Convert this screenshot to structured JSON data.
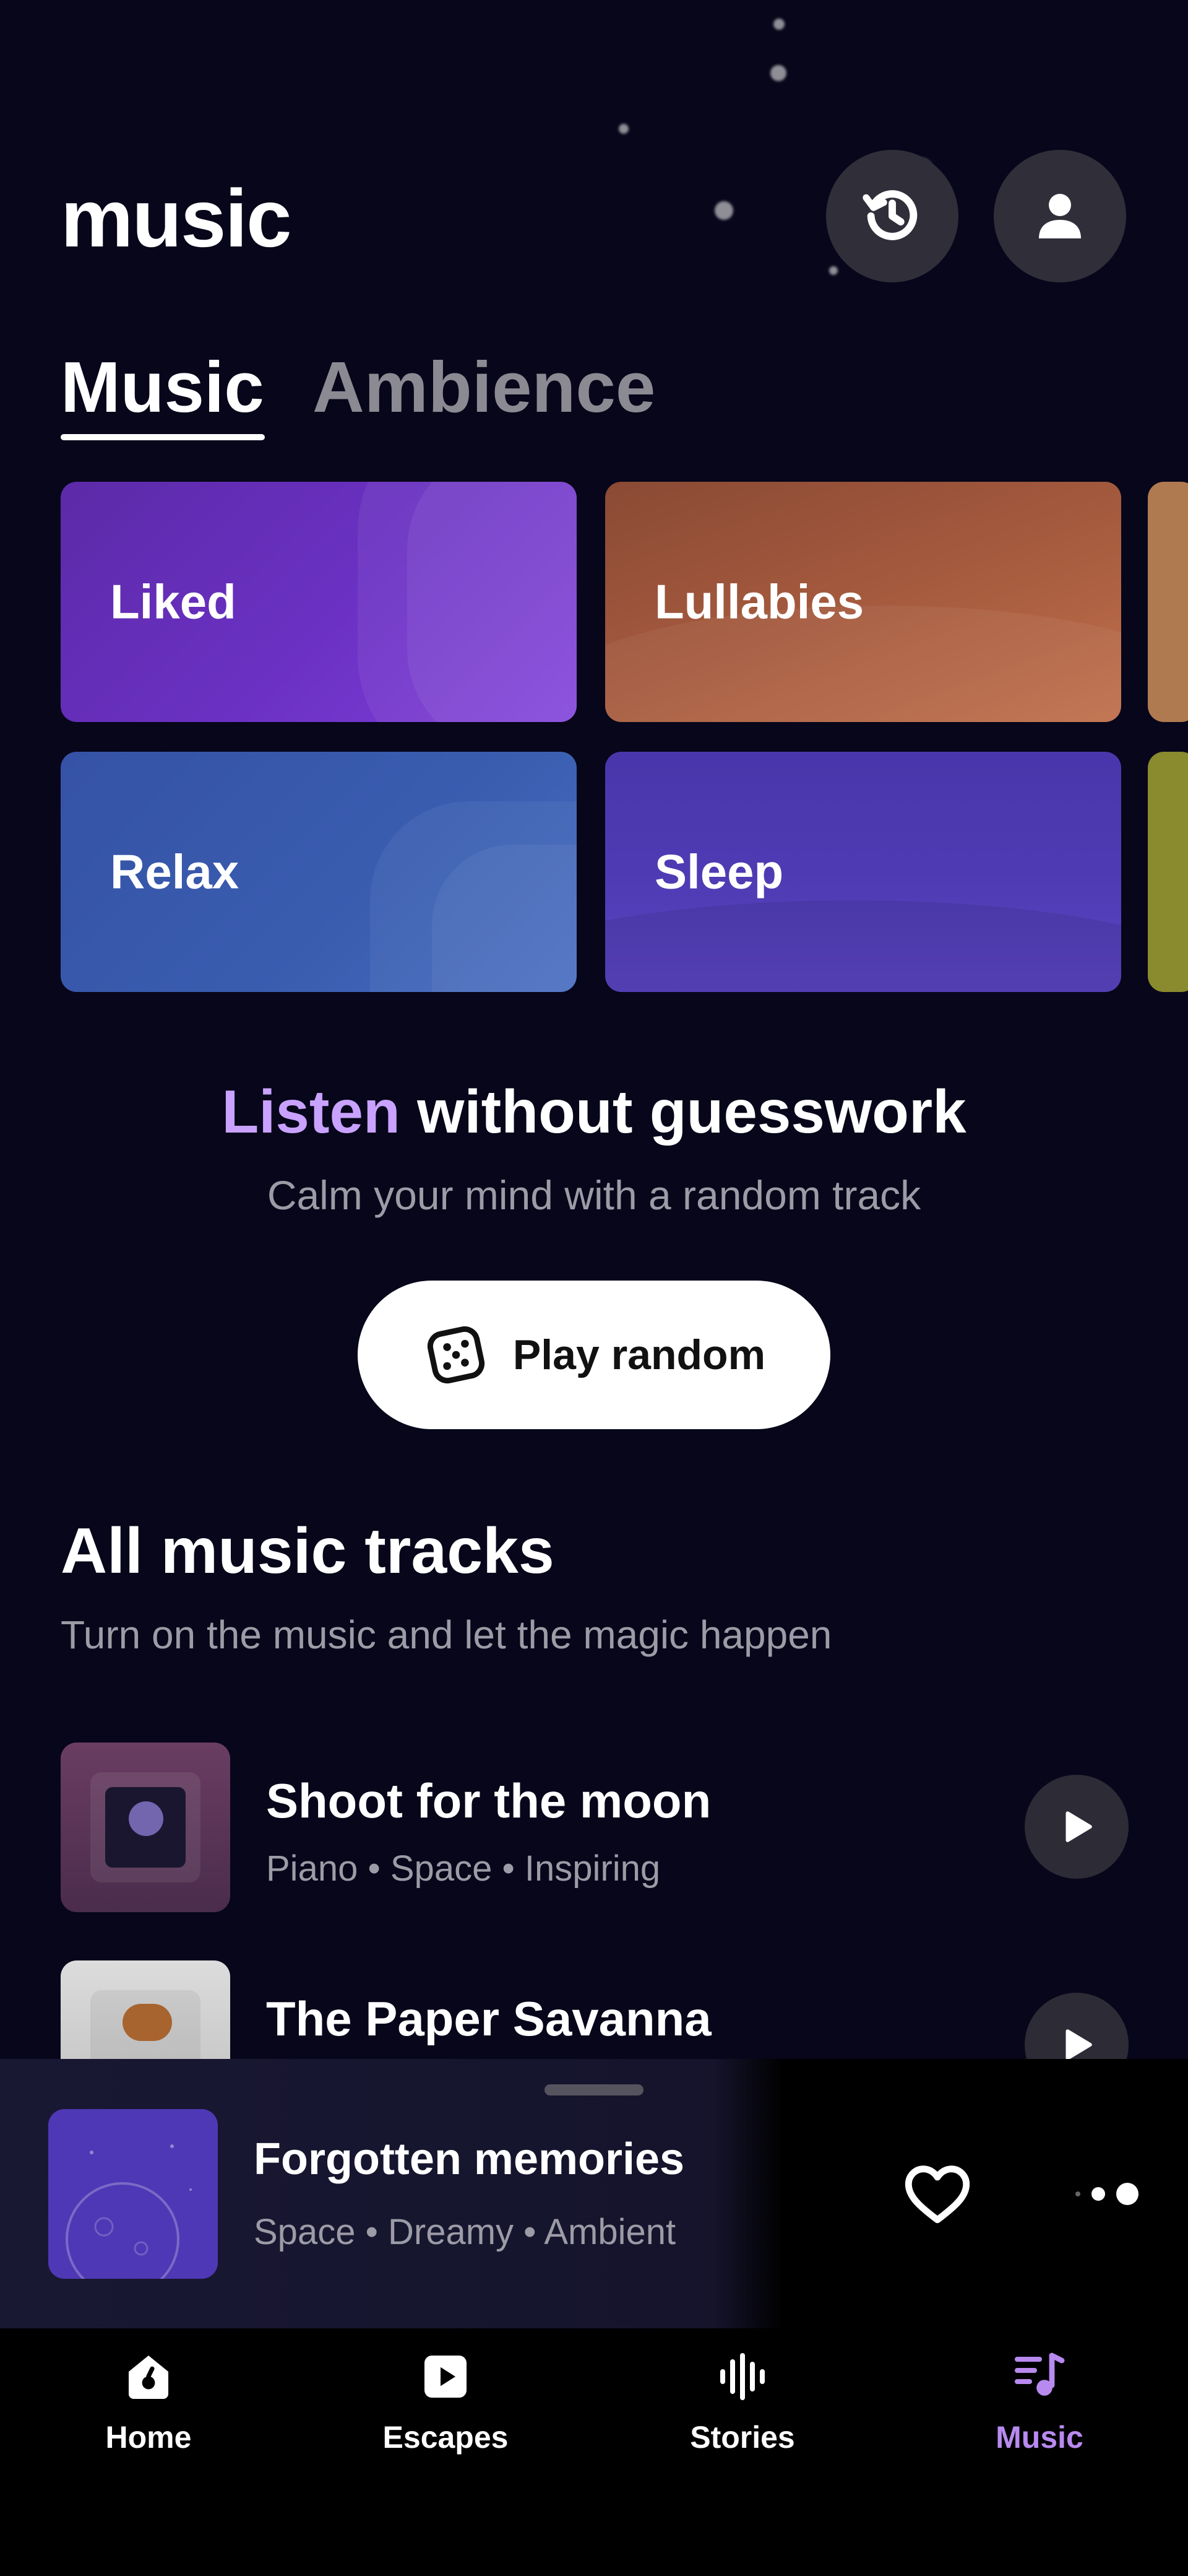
{
  "header": {
    "title": "music"
  },
  "tabs": [
    {
      "label": "Music",
      "active": true
    },
    {
      "label": "Ambience",
      "active": false
    }
  ],
  "categories": [
    {
      "label": "Liked",
      "color": "#6b31c4"
    },
    {
      "label": "Lullabies",
      "color": "#a55a3e"
    },
    {
      "label": "Relax",
      "color": "#3a5db0"
    },
    {
      "label": "Sleep",
      "color": "#4e3bb3"
    }
  ],
  "promo": {
    "title_accent": "Listen",
    "title_rest": "without guesswork",
    "subtitle": "Calm your mind with a random track",
    "button_label": "Play random"
  },
  "section": {
    "title": "All music tracks",
    "subtitle": "Turn on the music and let the magic happen"
  },
  "tracks": [
    {
      "title": "Shoot for the moon",
      "tags": "Piano • Space • Inspiring"
    },
    {
      "title": "The Paper Savanna",
      "tags": ""
    }
  ],
  "now_playing": {
    "title": "Forgotten memories",
    "tags": "Space • Dreamy • Ambient"
  },
  "nav": [
    {
      "label": "Home",
      "icon": "home-icon",
      "active": false
    },
    {
      "label": "Escapes",
      "icon": "play-square-icon",
      "active": false
    },
    {
      "label": "Stories",
      "icon": "waveform-icon",
      "active": false
    },
    {
      "label": "Music",
      "icon": "music-note-icon",
      "active": true
    }
  ],
  "colors": {
    "background": "#07061a",
    "accent": "#c9a2ff",
    "nav_active": "#b88af0"
  }
}
